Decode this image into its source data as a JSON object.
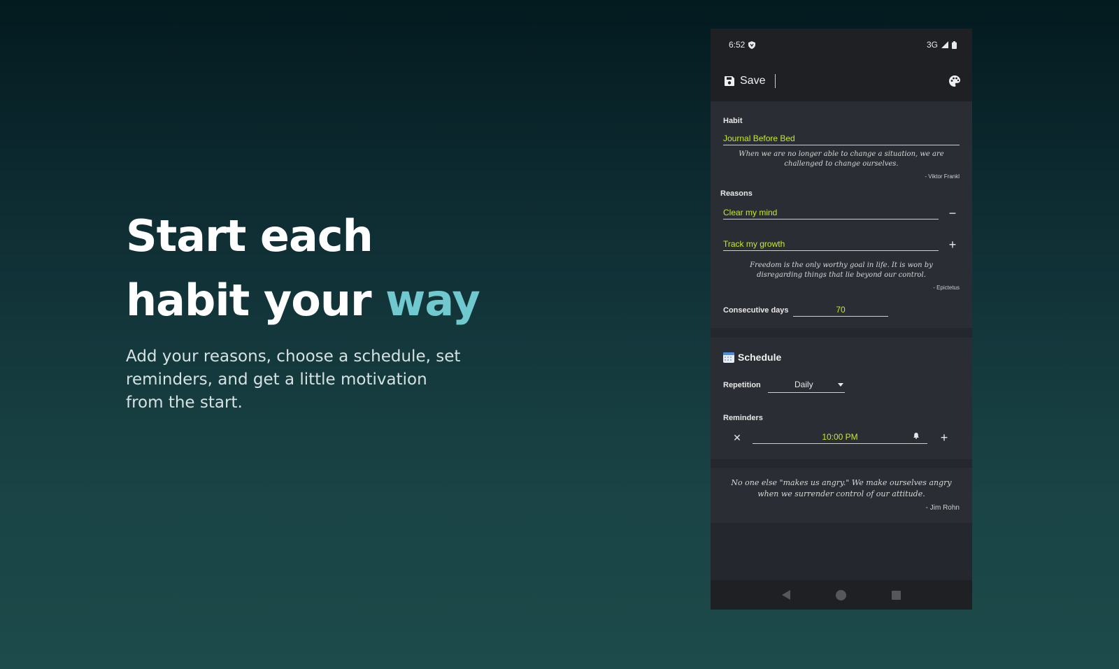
{
  "hero": {
    "title_line1": "Start each",
    "title_line2_prefix": "habit your ",
    "title_line2_accent": "way",
    "subtitle": "Add your reasons, choose a schedule, set reminders, and get a little motivation from the start."
  },
  "phone": {
    "status": {
      "time": "6:52",
      "network": "3G"
    },
    "appbar": {
      "save_label": "Save"
    },
    "habit": {
      "label": "Habit",
      "value": "Journal Before Bed",
      "quote": "When we are no longer able to change a situation, we are challenged to change ourselves.",
      "author": "- Viktor Frankl"
    },
    "reasons": {
      "label": "Reasons",
      "items": [
        "Clear my mind",
        "Track my growth"
      ],
      "quote": "Freedom is the only worthy goal in life. It is won by disregarding things that lie beyond our control.",
      "author": "- Epictetus"
    },
    "consecutive": {
      "label": "Consecutive days",
      "value": "70"
    },
    "schedule": {
      "title": "Schedule",
      "repetition_label": "Repetition",
      "repetition_value": "Daily",
      "reminders_label": "Reminders",
      "reminder_time": "10:00 PM"
    },
    "footer_quote": {
      "quote": "No one else \"makes us angry.\" We make ourselves angry when we surrender control of our attitude.",
      "author": "- Jim Rohn"
    }
  },
  "colors": {
    "accent": "#6fc9cf",
    "field_text": "#c9e829",
    "phone_bg": "#25272e"
  },
  "icons": [
    "shield-icon",
    "signal-icon",
    "battery-icon",
    "save-icon",
    "palette-icon",
    "minus-icon",
    "plus-icon",
    "calendar-icon",
    "dropdown-arrow-icon",
    "close-icon",
    "bell-icon",
    "nav-back-icon",
    "nav-home-icon",
    "nav-recent-icon"
  ]
}
